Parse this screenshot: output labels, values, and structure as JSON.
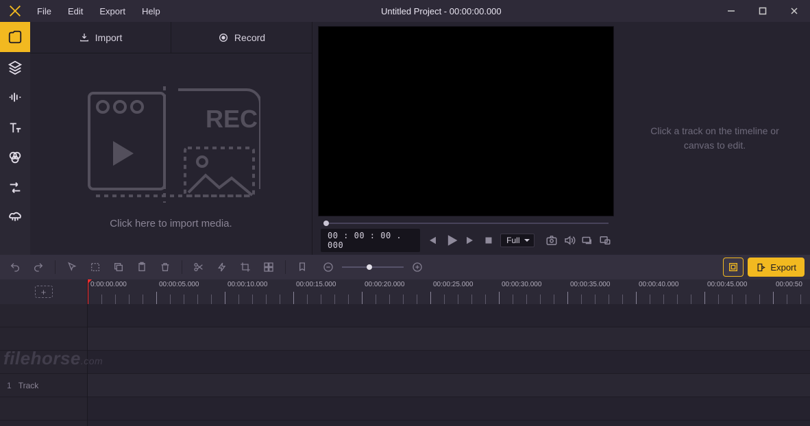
{
  "window": {
    "title": "Untitled Project - 00:00:00.000"
  },
  "menu": {
    "file": "File",
    "edit": "Edit",
    "export": "Export",
    "help": "Help"
  },
  "media": {
    "import_label": "Import",
    "record_label": "Record",
    "hint": "Click here to import media."
  },
  "preview": {
    "timecode": "00 : 00 : 00 . 000",
    "zoom_mode": "Full"
  },
  "props": {
    "placeholder": "Click a track on the timeline or canvas to edit."
  },
  "toolbar": {
    "export_label": "Export"
  },
  "timeline": {
    "add_label": "+",
    "track1_num": "1",
    "track1_label": "Track",
    "ruler": [
      "0:00:00.000",
      "00:00:05.000",
      "00:00:10.000",
      "00:00:15.000",
      "00:00:20.000",
      "00:00:25.000",
      "00:00:30.000",
      "00:00:35.000",
      "00:00:40.000",
      "00:00:45.000",
      "00:00:50"
    ]
  },
  "watermark": {
    "main": "filehorse",
    "tld": ".com"
  }
}
